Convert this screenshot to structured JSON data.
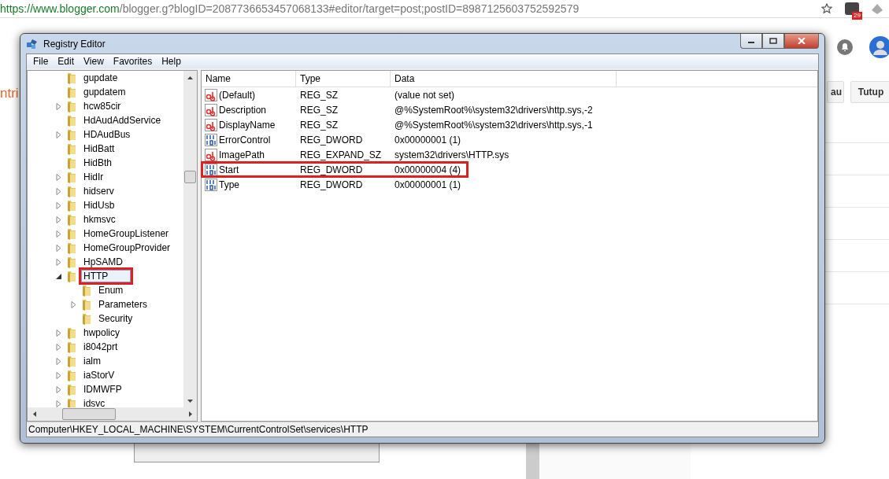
{
  "browser": {
    "url_host": "https://www.blogger.com",
    "url_rest": "/blogger.g?blogID=2087736653457068133#editor/target=post;postID=8987125603752592579",
    "badge": "29"
  },
  "page_behind": {
    "title_fragment": "ntri",
    "buttons": [
      "au",
      "Tutup"
    ]
  },
  "window": {
    "title": "Registry Editor"
  },
  "menu": [
    "File",
    "Edit",
    "View",
    "Favorites",
    "Help"
  ],
  "tree": [
    {
      "label": "gupdate",
      "kind": "leaf",
      "selected": false,
      "annotated": false
    },
    {
      "label": "gupdatem",
      "kind": "leaf",
      "selected": false,
      "annotated": false
    },
    {
      "label": "hcw85cir",
      "kind": "collapsed",
      "selected": false,
      "annotated": false
    },
    {
      "label": "HdAudAddService",
      "kind": "leaf",
      "selected": false,
      "annotated": false
    },
    {
      "label": "HDAudBus",
      "kind": "collapsed",
      "selected": false,
      "annotated": false
    },
    {
      "label": "HidBatt",
      "kind": "leaf",
      "selected": false,
      "annotated": false
    },
    {
      "label": "HidBth",
      "kind": "leaf",
      "selected": false,
      "annotated": false
    },
    {
      "label": "HidIr",
      "kind": "collapsed",
      "selected": false,
      "annotated": false
    },
    {
      "label": "hidserv",
      "kind": "collapsed",
      "selected": false,
      "annotated": false
    },
    {
      "label": "HidUsb",
      "kind": "collapsed",
      "selected": false,
      "annotated": false
    },
    {
      "label": "hkmsvc",
      "kind": "collapsed",
      "selected": false,
      "annotated": false
    },
    {
      "label": "HomeGroupListener",
      "kind": "collapsed",
      "selected": false,
      "annotated": false
    },
    {
      "label": "HomeGroupProvider",
      "kind": "collapsed",
      "selected": false,
      "annotated": false
    },
    {
      "label": "HpSAMD",
      "kind": "collapsed",
      "selected": false,
      "annotated": false
    },
    {
      "label": "HTTP",
      "kind": "expanded",
      "selected": true,
      "annotated": true,
      "children": [
        {
          "label": "Enum",
          "kind": "leaf",
          "selected": false,
          "annotated": false
        },
        {
          "label": "Parameters",
          "kind": "collapsed",
          "selected": false,
          "annotated": false
        },
        {
          "label": "Security",
          "kind": "leaf",
          "selected": false,
          "annotated": false
        }
      ]
    },
    {
      "label": "hwpolicy",
      "kind": "collapsed",
      "selected": false,
      "annotated": false
    },
    {
      "label": "i8042prt",
      "kind": "collapsed",
      "selected": false,
      "annotated": false
    },
    {
      "label": "ialm",
      "kind": "collapsed",
      "selected": false,
      "annotated": false
    },
    {
      "label": "iaStorV",
      "kind": "collapsed",
      "selected": false,
      "annotated": false
    },
    {
      "label": "IDMWFP",
      "kind": "collapsed",
      "selected": false,
      "annotated": false
    },
    {
      "label": "idsvc",
      "kind": "collapsed",
      "selected": false,
      "annotated": false
    }
  ],
  "columns": [
    "Name",
    "Type",
    "Data"
  ],
  "values": [
    {
      "kind": "string",
      "name": "(Default)",
      "type": "REG_SZ",
      "data": "(value not set)",
      "annotated": false
    },
    {
      "kind": "string",
      "name": "Description",
      "type": "REG_SZ",
      "data": "@%SystemRoot%\\system32\\drivers\\http.sys,-2",
      "annotated": false
    },
    {
      "kind": "string",
      "name": "DisplayName",
      "type": "REG_SZ",
      "data": "@%SystemRoot%\\system32\\drivers\\http.sys,-1",
      "annotated": false
    },
    {
      "kind": "binary",
      "name": "ErrorControl",
      "type": "REG_DWORD",
      "data": "0x00000001 (1)",
      "annotated": false
    },
    {
      "kind": "string",
      "name": "ImagePath",
      "type": "REG_EXPAND_SZ",
      "data": "system32\\drivers\\HTTP.sys",
      "annotated": false
    },
    {
      "kind": "binary",
      "name": "Start",
      "type": "REG_DWORD",
      "data": "0x00000004 (4)",
      "annotated": true
    },
    {
      "kind": "binary",
      "name": "Type",
      "type": "REG_DWORD",
      "data": "0x00000001 (1)",
      "annotated": false
    }
  ],
  "status_bar": "Computer\\HKEY_LOCAL_MACHINE\\SYSTEM\\CurrentControlSet\\services\\HTTP"
}
